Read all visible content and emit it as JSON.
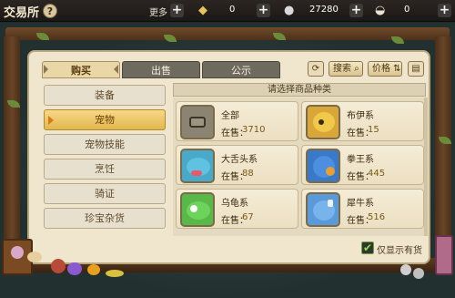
{
  "header": {
    "title": "交易所",
    "help_glyph": "?",
    "more_label": "更多",
    "currencies": [
      {
        "icon": "gold-ingot-icon",
        "value": "0"
      },
      {
        "icon": "silver-coin-icon",
        "value": "27280"
      },
      {
        "icon": "shell-icon",
        "value": "0"
      }
    ]
  },
  "tabs": [
    {
      "label": "购买",
      "active": true
    },
    {
      "label": "出售",
      "active": false
    },
    {
      "label": "公示",
      "active": false
    }
  ],
  "toolbar": {
    "search_label": "搜索",
    "price_label": "价格"
  },
  "categories": [
    {
      "label": "装备",
      "active": false
    },
    {
      "label": "宠物",
      "active": true
    },
    {
      "label": "宠物技能",
      "active": false
    },
    {
      "label": "烹饪",
      "active": false
    },
    {
      "label": "骑证",
      "active": false
    },
    {
      "label": "珍宝杂货",
      "active": false
    }
  ],
  "list_header": "请选择商品种类",
  "sale_label": "在售：",
  "items": [
    {
      "name": "全部",
      "count": "3710"
    },
    {
      "name": "布伊系",
      "count": "15"
    },
    {
      "name": "大舌头系",
      "count": "88"
    },
    {
      "name": "拳王系",
      "count": "445"
    },
    {
      "name": "乌龟系",
      "count": "67"
    },
    {
      "name": "犀牛系",
      "count": "516"
    }
  ],
  "only_show_in_stock": {
    "label": "仅显示有货",
    "checked": true
  },
  "colors": {
    "accent_gold": "#e2b84e",
    "panel": "#efe6cd",
    "tab_active": "#e9d8a6"
  }
}
